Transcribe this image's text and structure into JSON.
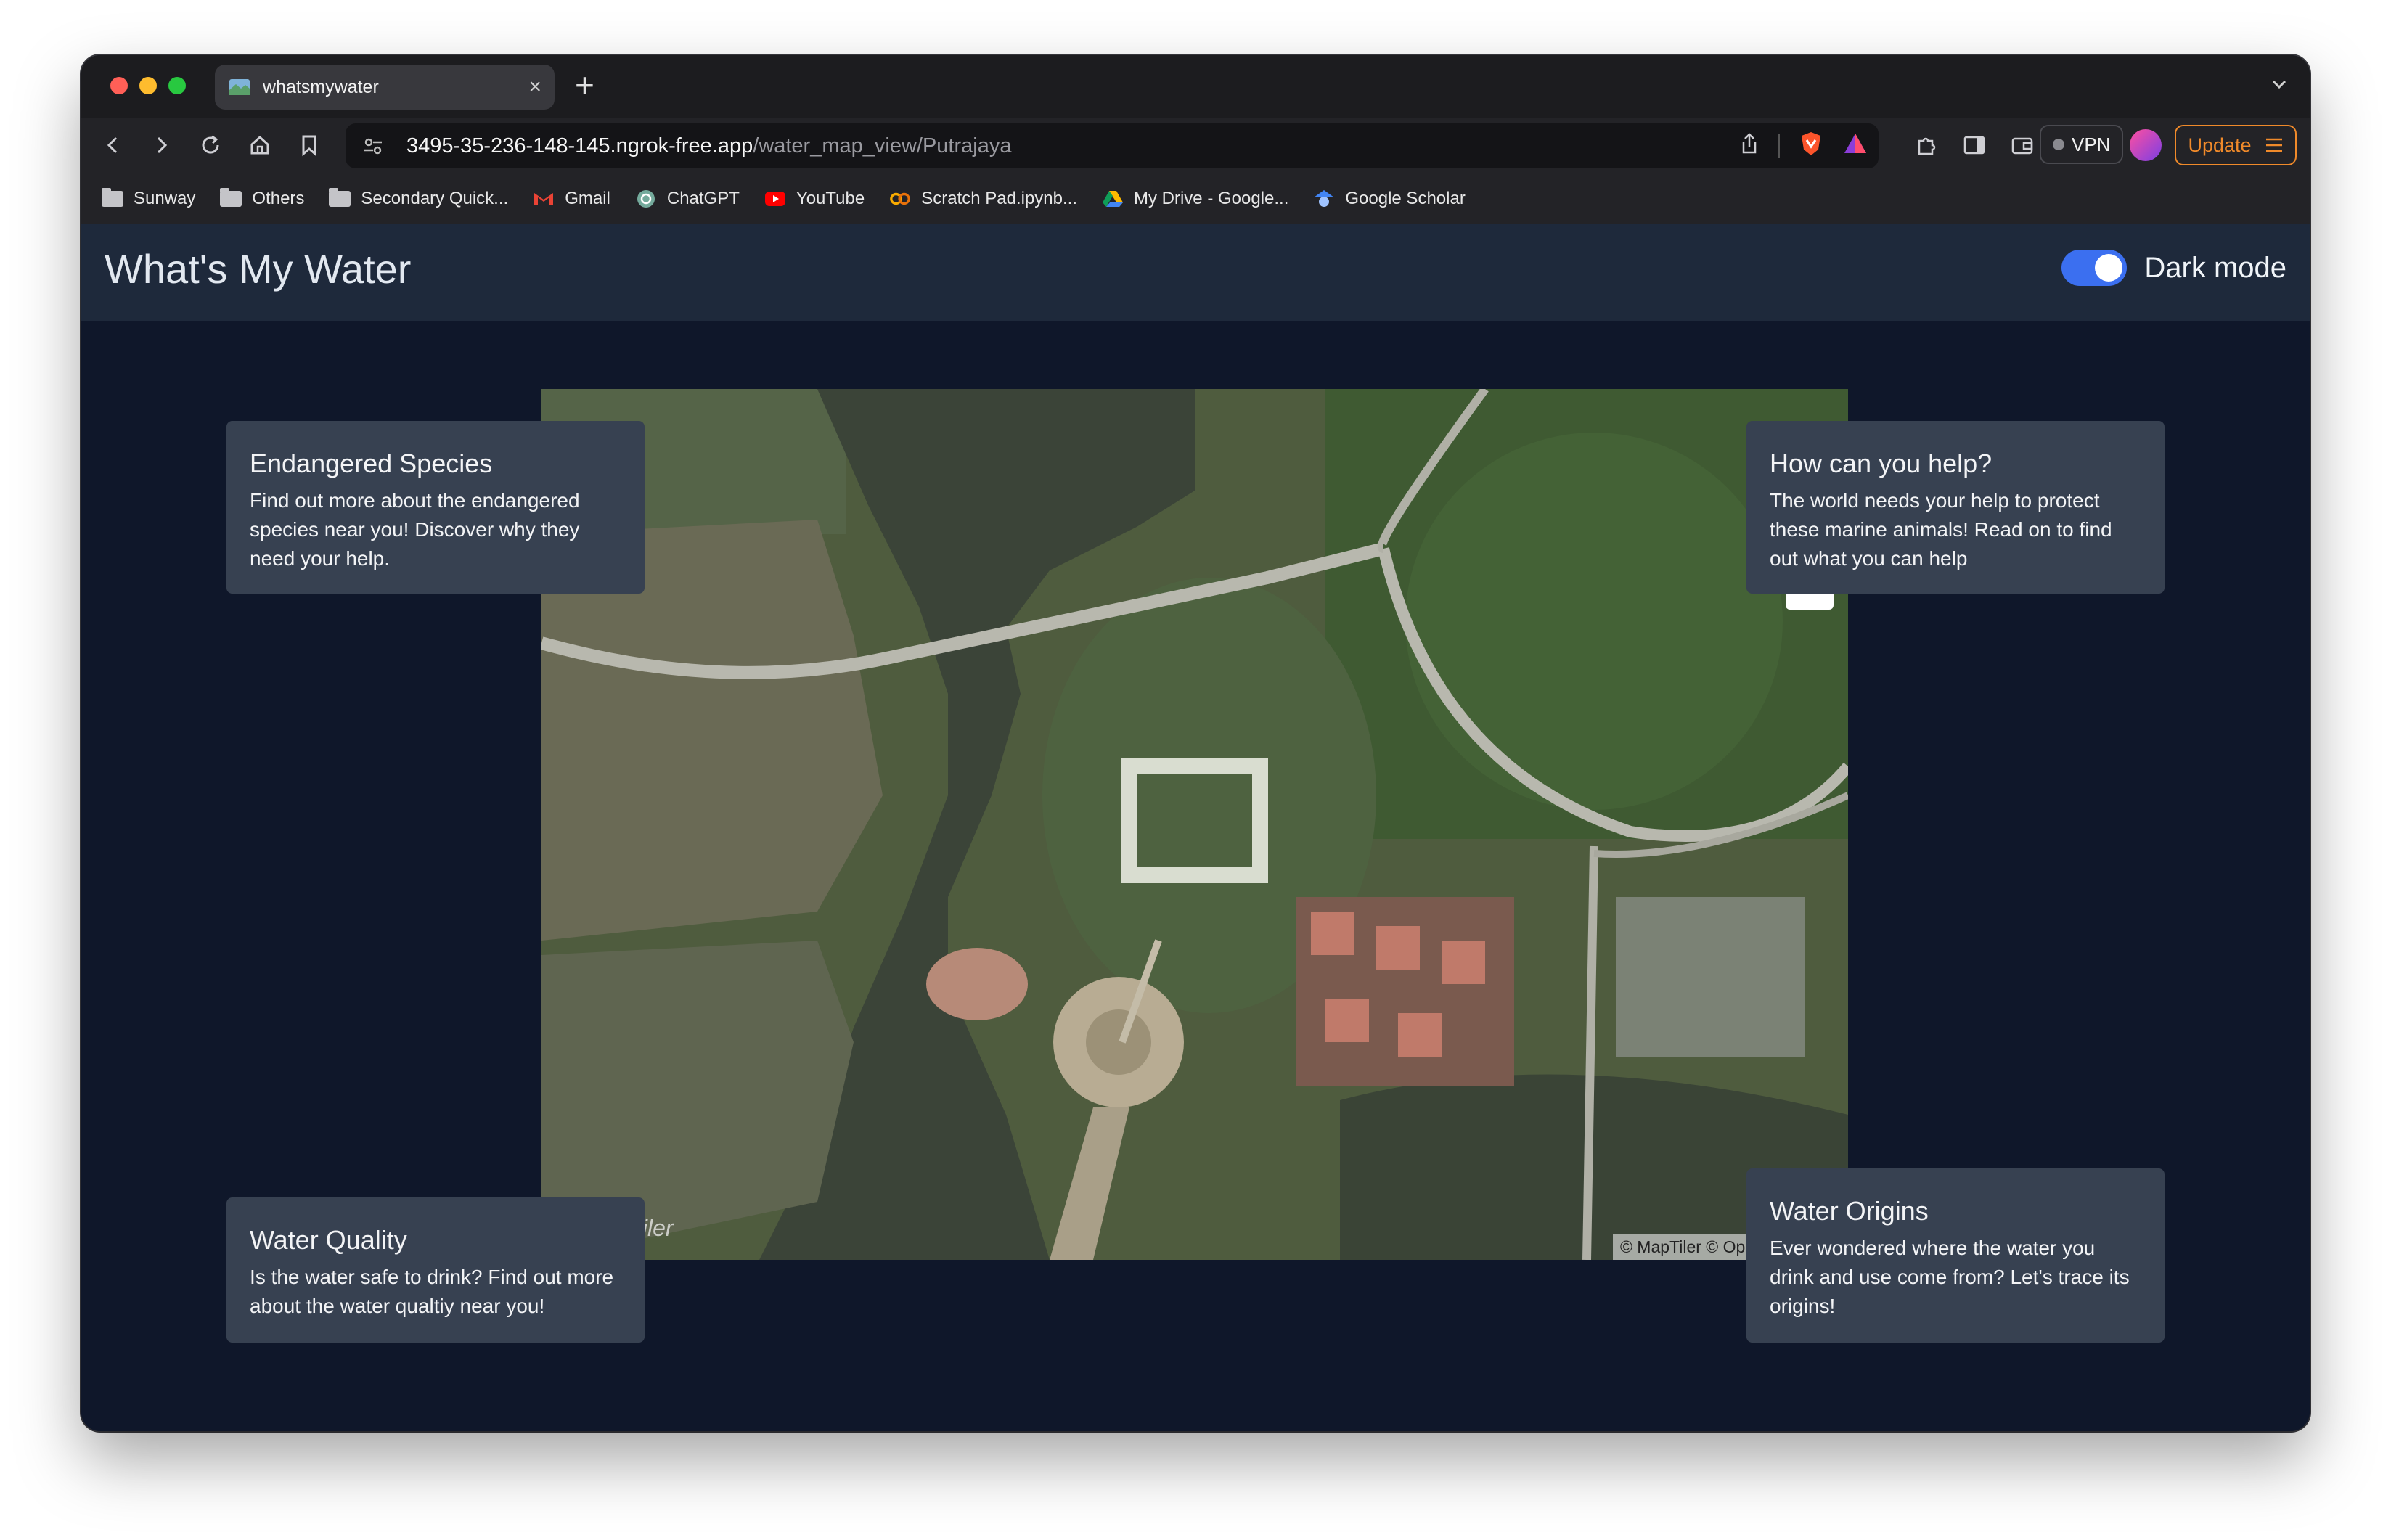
{
  "browser": {
    "tab_title": "whatsmywater",
    "tab_close": "×",
    "new_tab": "+",
    "url_host": "3495-35-236-148-145.ngrok-free.app",
    "url_path": "/water_map_view/Putrajaya",
    "vpn_label": "VPN",
    "update_label": "Update",
    "bookmarks": [
      {
        "label": "Sunway",
        "icon": "folder-icon"
      },
      {
        "label": "Others",
        "icon": "folder-icon"
      },
      {
        "label": "Secondary Quick...",
        "icon": "folder-icon"
      },
      {
        "label": "Gmail",
        "icon": "gmail-icon"
      },
      {
        "label": "ChatGPT",
        "icon": "chatgpt-icon"
      },
      {
        "label": "YouTube",
        "icon": "youtube-icon"
      },
      {
        "label": "Scratch Pad.ipynb...",
        "icon": "colab-icon"
      },
      {
        "label": "My Drive - Google...",
        "icon": "drive-icon"
      },
      {
        "label": "Google Scholar",
        "icon": "scholar-icon"
      }
    ]
  },
  "app": {
    "title": "What's My Water",
    "dark_mode_label": "Dark mode",
    "dark_mode_on": true,
    "accent_color": "#3b6ff0"
  },
  "map": {
    "watermark": "tiler",
    "attribution": "© MapTiler © OpenStreetMap"
  },
  "cards": {
    "endangered": {
      "title": "Endangered Species",
      "body": "Find out more about the endangered species near you! Discover why they need your help."
    },
    "help": {
      "title": "How can you help?",
      "body": "The world needs your help to protect these marine animals! Read on to find out what you can help"
    },
    "quality": {
      "title": "Water Quality",
      "body": "Is the water safe to drink? Find out more about the water qualtiy near you!"
    },
    "origins": {
      "title": "Water Origins",
      "body": "Ever wondered where the water you drink and use come from? Let's trace its origins!"
    }
  }
}
